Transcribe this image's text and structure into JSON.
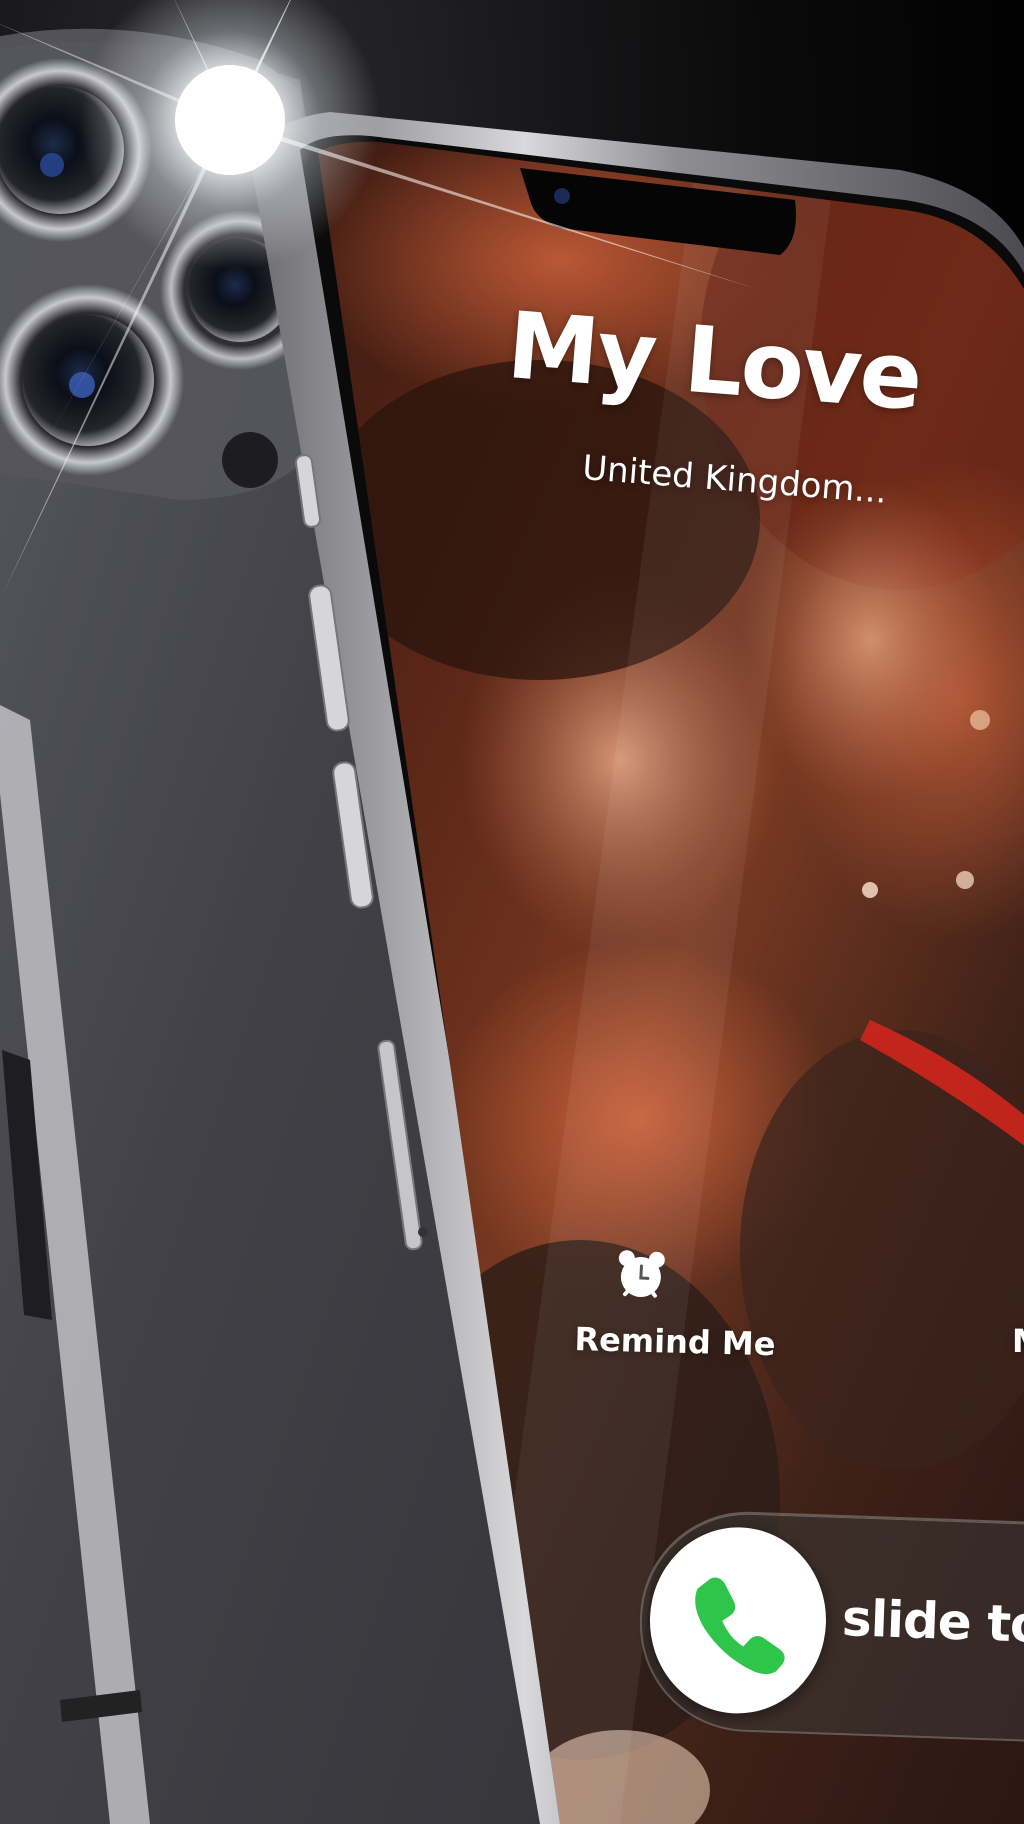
{
  "call": {
    "caller_name": "My Love",
    "caller_location": "United Kingdom...",
    "remind_label": "Remind Me",
    "message_label_partial": "M",
    "slide_label": "slide to an"
  },
  "icons": {
    "remind": "alarm-clock-icon",
    "answer": "phone-handset-icon"
  },
  "colors": {
    "accent_orange": "#F08A24",
    "answer_green": "#2FC54B",
    "phone_frame": "#3E3E44",
    "background": "#000000"
  }
}
